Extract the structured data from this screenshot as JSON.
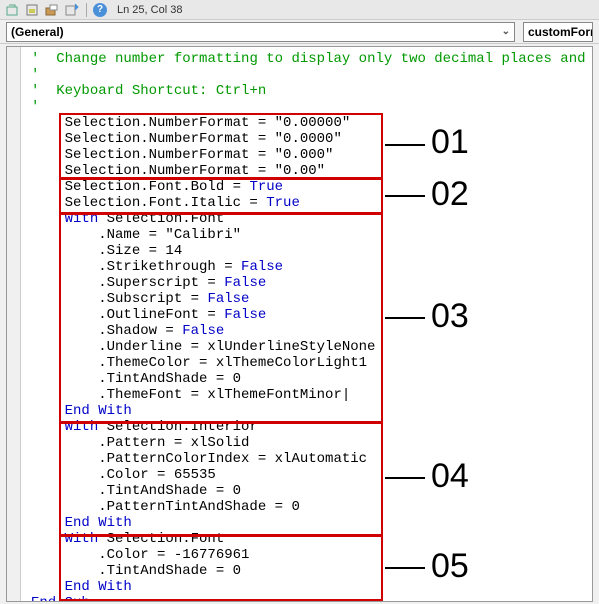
{
  "toolbar": {
    "cursor_pos": "Ln 25, Col 38"
  },
  "dropdowns": {
    "object": "(General)",
    "proc": "customForm"
  },
  "callouts": {
    "c1": "01",
    "c2": "02",
    "c3": "03",
    "c4": "04",
    "c5": "05"
  },
  "code": {
    "cmt_prefix": "' ",
    "cmt1": "Change number formatting to display only two decimal places and chan",
    "cmt2": "Keyboard Shortcut: Ctrl+n",
    "nf1a": "    Selection.NumberFormat = ",
    "nf1b": "\"0.00000\"",
    "nf2a": "    Selection.NumberFormat = ",
    "nf2b": "\"0.0000\"",
    "nf3a": "    Selection.NumberFormat = ",
    "nf3b": "\"0.000\"",
    "nf4a": "    Selection.NumberFormat = ",
    "nf4b": "\"0.00\"",
    "bold_a": "    Selection.Font.Bold = ",
    "true_kw": "True",
    "ital_a": "    Selection.Font.Italic = ",
    "with_kw": "With",
    "endwith_kw": "End With",
    "false_kw": "False",
    "w1_head": " Selection.Font",
    "w1_l1a": "        .Name = ",
    "w1_l1b": "\"Calibri\"",
    "w1_l2": "        .Size = 14",
    "w1_l3": "        .Strikethrough = ",
    "w1_l4": "        .Superscript = ",
    "w1_l5": "        .Subscript = ",
    "w1_l6": "        .OutlineFont = ",
    "w1_l7": "        .Shadow = ",
    "w1_l8": "        .Underline = xlUnderlineStyleNone",
    "w1_l9": "        .ThemeColor = xlThemeColorLight1",
    "w1_l10": "        .TintAndShade = 0",
    "w1_l11": "        .ThemeFont = xlThemeFontMinor",
    "caret": "|",
    "w1_end_ind": "    ",
    "w2_head": " Selection.Interior",
    "w2_l1": "        .Pattern = xlSolid",
    "w2_l2": "        .PatternColorIndex = xlAutomatic",
    "w2_l3": "        .Color = 65535",
    "w2_l4": "        .TintAndShade = 0",
    "w2_l5": "        .PatternTintAndShade = 0",
    "w2_end_ind": "    ",
    "w3_head": " Selection.Font",
    "w3_l1": "        .Color = -16776961",
    "w3_l2": "        .TintAndShade = 0",
    "w3_end_ind": "    ",
    "end_sub": "End Sub",
    "indent4": "    "
  }
}
